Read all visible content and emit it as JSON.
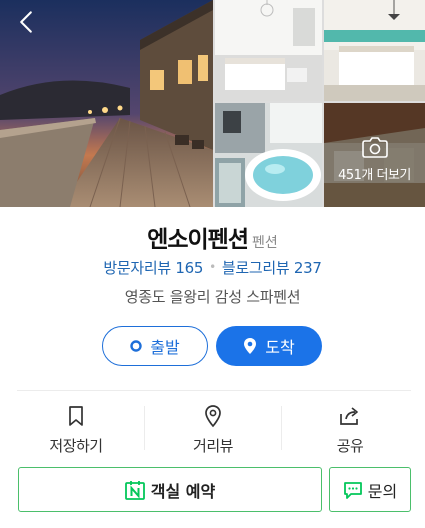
{
  "gallery": {
    "more_label": "451개 더보기",
    "photos": [
      "pension-deck-night-photo",
      "bedroom-white-photo",
      "bedroom-turquoise-photo",
      "spa-bathtub-photo",
      "terrace-photo"
    ]
  },
  "place": {
    "name": "엔소이펜션",
    "category": "펜션",
    "visitor_reviews": "방문자리뷰 165",
    "blog_reviews": "블로그리뷰 237",
    "subtitle": "영종도 을왕리 감성 스파펜션"
  },
  "route": {
    "depart_label": "출발",
    "arrive_label": "도착"
  },
  "actions": {
    "save_label": "저장하기",
    "street_view_label": "거리뷰",
    "share_label": "공유"
  },
  "bottom": {
    "reserve_label": "객실 예약",
    "inquiry_label": "문의"
  },
  "colors": {
    "primary_blue": "#1b73e8",
    "review_link": "#1f66b2",
    "naver_green": "#03c75a",
    "border_green": "#4bbf6b"
  }
}
